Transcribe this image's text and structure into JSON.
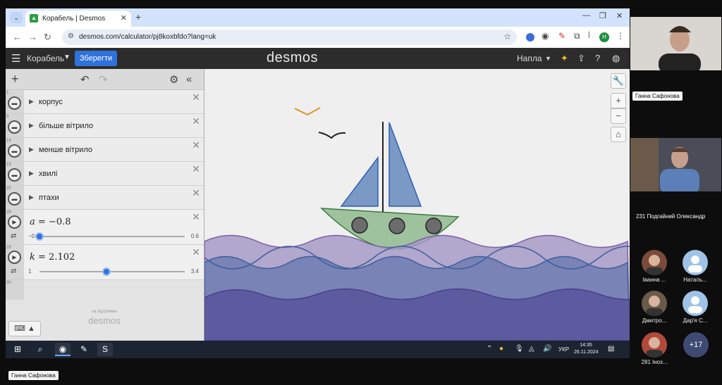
{
  "browser": {
    "tab_title": "Корабель | Desmos",
    "url": "desmos.com/calculator/pj8koxbfdo?lang=uk",
    "profile_initial": "Н"
  },
  "header": {
    "graph_title": "Корабель",
    "save_label": "Зберегти",
    "logo": "desmos",
    "user_name": "Напла"
  },
  "expressions": {
    "folders": [
      {
        "num": "1",
        "label": "корпус"
      },
      {
        "num": "9",
        "label": "більше вітрило"
      },
      {
        "num": "14",
        "label": "менше вітрило"
      },
      {
        "num": "19",
        "label": "хвилі"
      },
      {
        "num": "25",
        "label": "птахи"
      }
    ],
    "sliders": [
      {
        "num": "28",
        "var": "a",
        "expr": "= −0.8",
        "min": "−0.8",
        "max": "0.6",
        "value": -0.8,
        "lo": -0.8,
        "hi": 0.6
      },
      {
        "num": "29",
        "var": "k",
        "expr": "= 2.102",
        "min": "1",
        "max": "3.4",
        "value": 2.102,
        "lo": 1,
        "hi": 3.4
      }
    ],
    "last_num": "30",
    "powered_by": "за підтримки",
    "powered_logo": "desmos"
  },
  "taskbar": {
    "lang": "УКР",
    "time": "14:35",
    "date": "26.11.2024"
  },
  "call": {
    "presenter_tag": "Ганна Сафонова",
    "participant2": "231 Подгайний Олександр",
    "tiles": [
      {
        "name": "Іванна ..."
      },
      {
        "name": "Наталь..."
      },
      {
        "name": "Дмитро..."
      },
      {
        "name": "Дар'я С..."
      },
      {
        "name": "281 Іноз..."
      }
    ],
    "more": "+17",
    "bottom_tag": "Ганна Сафонова"
  },
  "colors": {
    "accent": "#2f72dc",
    "wave_light": "#a79ac6",
    "wave_mid": "#6e7db0",
    "wave_dark": "#5a579c",
    "sail": "#7a99c4",
    "hull": "#9fc29e"
  }
}
